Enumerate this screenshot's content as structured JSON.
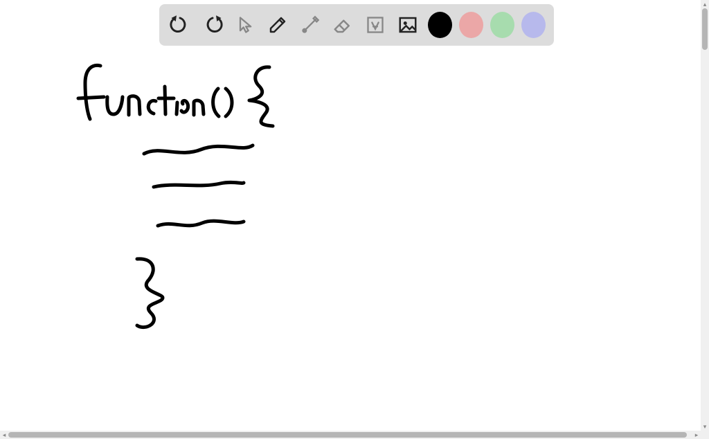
{
  "toolbar": {
    "tools": [
      {
        "name": "undo",
        "enabled": true
      },
      {
        "name": "redo",
        "enabled": true
      },
      {
        "name": "pointer",
        "enabled": false
      },
      {
        "name": "pen",
        "enabled": true
      },
      {
        "name": "tools",
        "enabled": false
      },
      {
        "name": "eraser",
        "enabled": false
      },
      {
        "name": "text",
        "enabled": false
      },
      {
        "name": "image",
        "enabled": true
      }
    ],
    "swatches": [
      {
        "name": "black",
        "color": "#000000",
        "selected": true
      },
      {
        "name": "pink",
        "color": "#eba7a7",
        "selected": false
      },
      {
        "name": "green",
        "color": "#a7dcae",
        "selected": false
      },
      {
        "name": "lavender",
        "color": "#b7b9ec",
        "selected": false
      }
    ]
  },
  "canvas": {
    "background": "#ffffff",
    "stroke_color": "#000000",
    "stroke_width": 5,
    "handwriting_text": "function() {",
    "handwriting_closing": "}",
    "body_lines": 3
  },
  "scrollbars": {
    "vertical": {
      "position": 0,
      "length": 60
    },
    "horizontal": {
      "position": 0,
      "length": 980
    }
  }
}
